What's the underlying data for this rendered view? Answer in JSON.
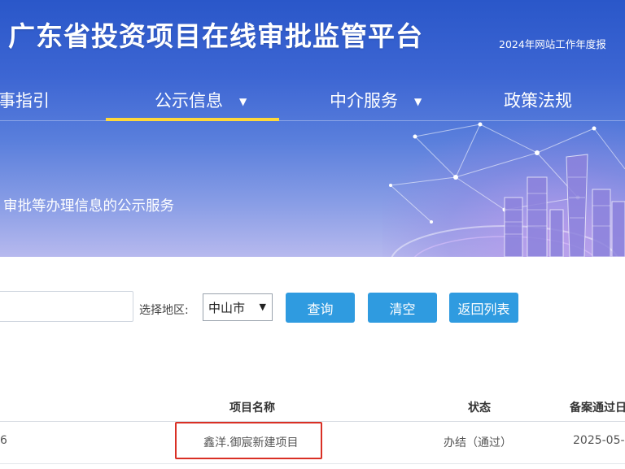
{
  "header": {
    "site_title": "广东省投资项目在线审批监管平台",
    "report_link": "2024年网站工作年度报"
  },
  "nav": {
    "items": [
      {
        "label": "事指引",
        "has_dropdown": false,
        "active": false
      },
      {
        "label": "公示信息",
        "has_dropdown": true,
        "active": true
      },
      {
        "label": "中介服务",
        "has_dropdown": true,
        "active": false
      },
      {
        "label": "政策法规",
        "has_dropdown": false,
        "active": false
      }
    ],
    "caret": "▼"
  },
  "banner": {
    "subtitle": "审批等办理信息的公示服务"
  },
  "search": {
    "keyword_value": "",
    "region_label": "选择地区:",
    "region_selected": "中山市",
    "select_arrow": "▼",
    "query_button": "查询",
    "clear_button": "清空",
    "back_button": "返回列表"
  },
  "table": {
    "columns": [
      "项目名称",
      "状态",
      "备案通过日"
    ],
    "rows": [
      {
        "code_tail": "6",
        "project_name": "鑫洋.御宸新建项目",
        "status": "办结（通过）",
        "date": "2025-05-"
      }
    ]
  },
  "colors": {
    "banner_blue": "#2a57c9",
    "nav_active_underline": "#ffd83a",
    "button_blue": "#2f9be0",
    "highlight_red": "#d93025"
  }
}
